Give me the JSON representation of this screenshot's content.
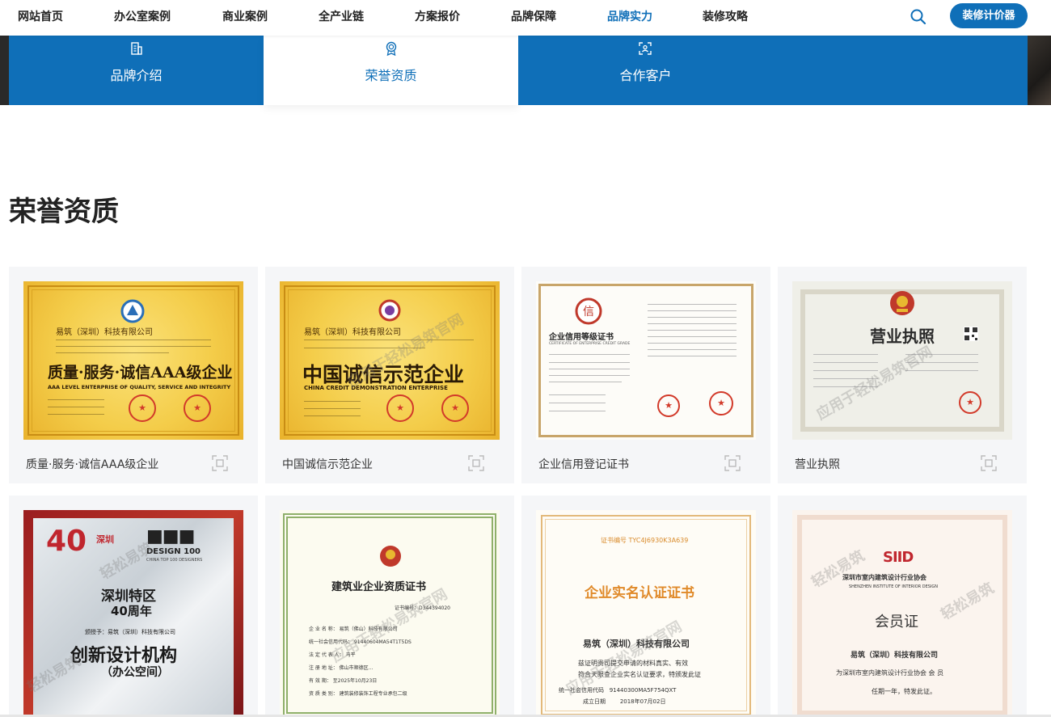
{
  "nav": {
    "items": [
      "网站首页",
      "办公室案例",
      "商业案例",
      "全产业链",
      "方案报价",
      "品牌保障",
      "品牌实力",
      "装修攻略"
    ],
    "active": "品牌实力",
    "cta_label": "装修计价器",
    "icons": [
      "search-icon"
    ]
  },
  "tabs": [
    {
      "label": "品牌介绍",
      "icon": "building-icon"
    },
    {
      "label": "荣誉资质",
      "icon": "award-icon"
    },
    {
      "label": "合作客户",
      "icon": "scan-user-icon"
    }
  ],
  "colors": {
    "brand_blue": "#0f6fb8",
    "card_bg": "#f5f6f8",
    "gold": "#f4cd4a",
    "seal_red": "#d23a2a"
  },
  "section_title": "荣誉资质",
  "certificates": [
    {
      "caption": "质量·服务·诚信AAA级企业",
      "company": "易筑（深圳）科技有限公司",
      "heading": "质量·服务·诚信AAA级企业",
      "subheading": "AAA LEVEL ENTERPRISE OF QUALITY, SERVICE AND INTEGRITY"
    },
    {
      "caption": "中国诚信示范企业",
      "company": "易筑（深圳）科技有限公司",
      "heading": "中国诚信示范企业",
      "subheading": "CHINA CREDIT DEMONSTRATION ENTERPRISE"
    },
    {
      "caption": "企业信用登记证书",
      "heading": "企业信用等级证书",
      "subheading": "CERTIFICATE OF ENTERPRISE CREDIT GRADE"
    },
    {
      "caption": "营业执照",
      "heading": "营业执照"
    },
    {
      "caption": "",
      "badge": "40",
      "badge_side": "深圳",
      "brand": "DESIGN 100",
      "brand_sub": "CHINA TOP 100 DESIGNERS",
      "line1": "深圳特区",
      "line2": "40周年",
      "awardee": "颁授予：易筑（深圳）科技有限公司",
      "heading": "创新设计机构",
      "subheading": "（办公空间）"
    },
    {
      "caption": "",
      "heading": "建筑业企业资质证书",
      "cert_no": "证书编号：D344394020",
      "fields": [
        {
          "label": "企 业 名 称：",
          "value": "易筑（佛山）科技有限公司"
        },
        {
          "label": "统一社会信用代码：",
          "value": "91440604MA54T1T5DS"
        },
        {
          "label": "法 定 代 表 人：",
          "value": "马平"
        },
        {
          "label": "注 册 地 址：",
          "value": "佛山市顺德区…"
        },
        {
          "label": "有 效 期：",
          "value": "至2025年10月23日"
        },
        {
          "label": "资 质 类 别：",
          "value": "建筑装修装饰工程专业承包二级"
        }
      ]
    },
    {
      "caption": "",
      "cert_no": "证书编号 TYC4J6930K3A639",
      "heading": "企业实名认证证书",
      "company": "易筑（深圳）科技有限公司",
      "body1": "兹证明贵司提交申请的材料真实、有效",
      "body2": "符合天眼查企业实名认证要求，特颁发此证",
      "code_label": "统一社会信用代码",
      "code": "91440300MA5F754QXT",
      "date_label": "成立日期",
      "date": "2018年07月02日"
    },
    {
      "caption": "",
      "logo": "SIID",
      "org": "深圳市室内建筑设计行业协会",
      "org_en": "SHENZHEN INSTITUTE OF INTERIOR DESIGN",
      "heading": "会员证",
      "company": "易筑（深圳）科技有限公司",
      "body": "为深圳市室内建筑设计行业协会 会 员",
      "term": "任期一年，特发此证。"
    }
  ],
  "watermarks": [
    "应用于轻松易筑官网",
    "轻松易筑"
  ]
}
